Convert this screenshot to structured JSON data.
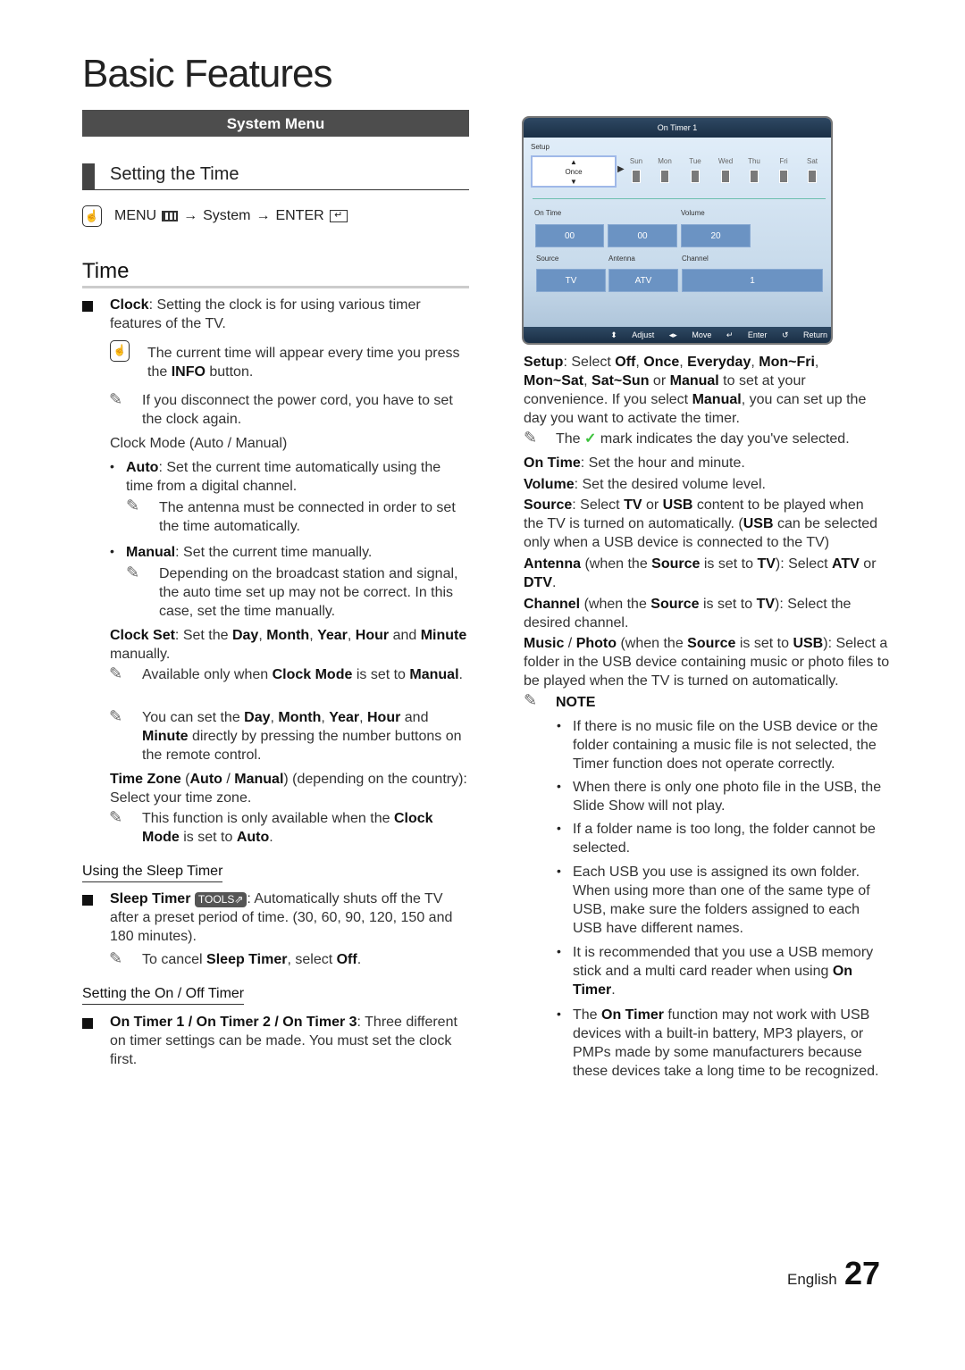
{
  "page": {
    "title": "Basic Features",
    "language": "English",
    "page_number": "27"
  },
  "left": {
    "section_bar": "System Menu",
    "setting_heading": "Setting the Time",
    "menu_path": {
      "menu": "MENU",
      "arrow1": "→",
      "system": "System",
      "arrow2": "→",
      "enter": "ENTER"
    },
    "time_heading": "Time",
    "clock": {
      "term": "Clock",
      "text": ": Setting the clock is for using various timer features of the TV."
    },
    "info_note": {
      "pre": "The current time will appear every time you press the ",
      "bold": "INFO",
      "post": " button."
    },
    "power_note": "If you disconnect the power cord, you have to set the clock again.",
    "clock_mode_heading": "Clock Mode (Auto / Manual)",
    "auto": {
      "term": "Auto",
      "text": ": Set the current time automatically using the time from a digital channel.",
      "note": "The antenna must be connected in order to set the time automatically."
    },
    "manual": {
      "term": "Manual",
      "text": ": Set the current time manually.",
      "note": "Depending on the broadcast station and signal, the auto time set up may not be correct. In this case, set the time manually."
    },
    "clock_set": {
      "term": "Clock Set",
      "t1": ": Set the ",
      "day": "Day",
      "month": "Month",
      "year": "Year",
      "hour": "Hour",
      "and": " and ",
      "minute": "Minute",
      "t2": " manually."
    },
    "clock_set_note1": {
      "pre": "Available only when ",
      "b1": "Clock Mode",
      "mid": " is set to ",
      "b2": "Manual",
      "post": "."
    },
    "clock_set_note2": {
      "pre": "You can set the ",
      "day": "Day",
      "month": "Month",
      "year": "Year",
      "hour": "Hour",
      "and": " and ",
      "minute": "Minute",
      "post": " directly by pressing the number buttons on the remote control."
    },
    "time_zone": {
      "term": "Time Zone",
      "auto": "Auto",
      "manual": "Manual",
      "text": " (depending on the country): Select your time zone."
    },
    "time_zone_note": {
      "pre": "This function is only available when the ",
      "b1": "Clock Mode",
      "mid": " is set to ",
      "b2": "Auto",
      "post": "."
    },
    "sleep_heading": "Using the Sleep Timer",
    "sleep": {
      "term": "Sleep Timer",
      "tools": "TOOLS",
      "text": ": Automatically shuts off the TV after a preset period of time. (30, 60, 90, 120, 150 and 180 minutes)."
    },
    "sleep_note": {
      "pre": "To cancel ",
      "b1": "Sleep Timer",
      "mid": ", select ",
      "b2": "Off",
      "post": "."
    },
    "onoff_heading": "Setting the On / Off Timer",
    "ontimer": {
      "term": "On Timer 1 / On Timer 2 / On Timer 3",
      "text": ": Three different on timer settings can be made. You must set the clock first."
    }
  },
  "tv_screen": {
    "title": "On Timer 1",
    "setup_label": "Setup",
    "setup_value": "Once",
    "days": [
      "Sun",
      "Mon",
      "Tue",
      "Wed",
      "Thu",
      "Fri",
      "Sat"
    ],
    "on_time_label": "On Time",
    "volume_label": "Volume",
    "hour": "00",
    "minute": "00",
    "volume": "20",
    "source_label": "Source",
    "antenna_label": "Antenna",
    "channel_label": "Channel",
    "source": "TV",
    "antenna": "ATV",
    "channel": "1",
    "footer": {
      "adjust": "Adjust",
      "move": "Move",
      "enter": "Enter",
      "return": "Return"
    }
  },
  "right": {
    "setup": {
      "term": "Setup",
      "t1": ": Select ",
      "o1": "Off",
      "o2": "Once",
      "o3": "Everyday",
      "o4": "Mon~Fri",
      "o5": "Mon~Sat",
      "o6": "Sat~Sun",
      "or": " or ",
      "o7": "Manual",
      "t2": " to set at your convenience. If you select ",
      "o8": "Manual",
      "t3": ", you can set up the day you want to activate the timer."
    },
    "check_note": {
      "pre": "The",
      "post": "mark indicates the day you've selected."
    },
    "on_time": {
      "term": "On Time",
      "text": ": Set the hour and minute."
    },
    "volume": {
      "term": "Volume",
      "text": ": Set the desired volume level."
    },
    "source": {
      "term": "Source",
      "t1": ": Select ",
      "tv": "TV",
      "or": " or ",
      "usb": "USB",
      "t2": " content to be played when the TV is turned on automatically. (",
      "usb2": "USB",
      "t3": " can be selected only when a USB device is connected to the TV)"
    },
    "antenna": {
      "term": "Antenna",
      "t1": " (when the ",
      "source": "Source",
      "t2": " is set to ",
      "tv": "TV",
      "t3": "): Select ",
      "atv": "ATV",
      "or": " or ",
      "dtv": "DTV",
      "t4": "."
    },
    "channel": {
      "term": "Channel",
      "t1": " (when the ",
      "source": "Source",
      "t2": " is set to ",
      "tv": "TV",
      "t3": "): Select the desired channel."
    },
    "music": {
      "term": "Music",
      "slash": " / ",
      "photo": "Photo",
      "t1": " (when the ",
      "source": "Source",
      "t2": " is set to ",
      "usb": "USB",
      "t3": "): Select a folder in the USB device containing music or photo files to be played when the TV is turned on automatically."
    },
    "note_label": "NOTE",
    "notes": [
      "If there is no music file on the USB device or the folder containing a music file is not selected, the Timer function does not operate correctly.",
      "When there is only one photo file in the USB, the Slide Show will not play.",
      "If a folder name is too long, the folder cannot be selected.",
      "Each USB you use is assigned its own folder. When using more than one of the same type of USB, make sure the folders assigned to each USB have different names."
    ],
    "note5": {
      "pre": "It is recommended that you use a USB memory stick and a multi card reader when using ",
      "b": "On Timer",
      "post": "."
    },
    "note6": {
      "pre": "The ",
      "b": "On Timer",
      "post": " function may not work with USB devices with a built-in battery, MP3 players, or PMPs made by some manufacturers because these devices take a long time to be recognized."
    }
  }
}
